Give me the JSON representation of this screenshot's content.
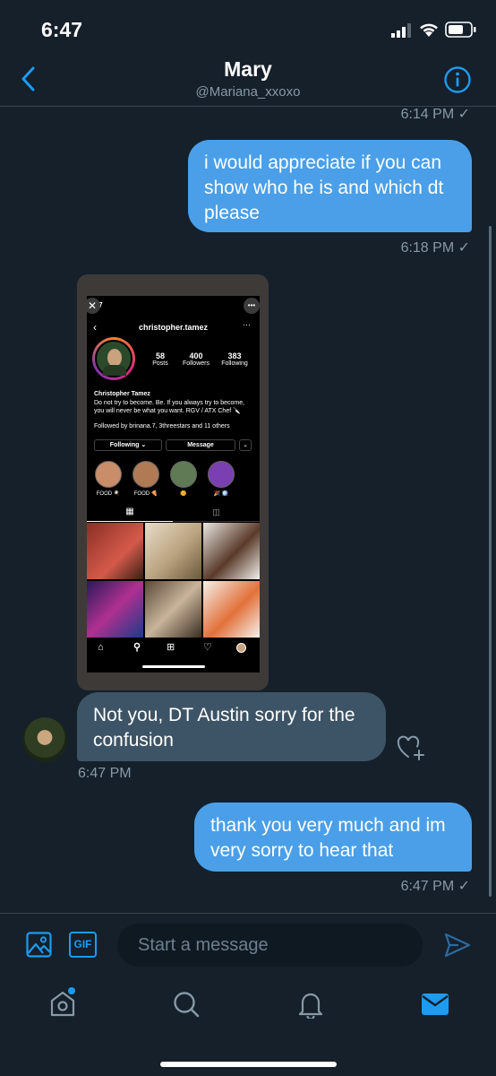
{
  "status_bar": {
    "time": "6:47"
  },
  "header": {
    "name": "Mary",
    "handle": "@Mariana_xxoxo"
  },
  "messages": {
    "ts_top": "6:14 PM ✓",
    "msg1": "i would appreciate if you can show who he is and which dt please",
    "ts1": "6:18 PM ✓",
    "msg2": "Not you, DT Austin sorry for the confusion",
    "ts2": "6:47 PM",
    "msg3": "thank you very much and im very sorry to hear that",
    "ts3": "6:47 PM ✓"
  },
  "screenshot": {
    "time": ":27",
    "username": "christopher.tamez",
    "stats": [
      {
        "value": "58",
        "label": "Posts"
      },
      {
        "value": "400",
        "label": "Followers"
      },
      {
        "value": "383",
        "label": "Following"
      }
    ],
    "bio_name": "Christopher Tamez",
    "bio_text": "Do not try to become. Be. If you always try to become, you will never be what you want. RGV / ATX Chef 🔪",
    "followed_by": "Followed by brinana.7, 3threestars and 11 others",
    "following_btn": "Following ⌄",
    "message_btn": "Message",
    "highlights": [
      "FOOD 🍳",
      "FOOD 🍕",
      "🌼",
      "🎉 🪩"
    ]
  },
  "composer": {
    "placeholder": "Start a message",
    "gif_label": "GIF"
  },
  "colors": {
    "background": "#15202b",
    "accent": "#1d9bf0",
    "bubble_out": "#4a9fe8",
    "bubble_in": "#3d5466"
  }
}
